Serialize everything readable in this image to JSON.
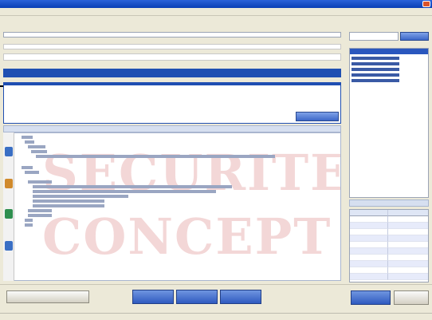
{
  "window": {
    "title": ""
  },
  "menu": {
    "items": []
  },
  "command_line": {
    "value": ""
  },
  "section": {
    "label": ""
  },
  "input_strip": {
    "value": ""
  },
  "text_area": {
    "lines": [
      "",
      "",
      ""
    ]
  },
  "ok_button": {
    "label": ""
  },
  "tree": {
    "header": "",
    "watermark": {
      "line1": "SECURITE",
      "line2": "CONCEPT"
    },
    "rows": [
      {
        "text": ""
      },
      {
        "text": ""
      },
      {
        "text": ""
      },
      {
        "text": ""
      },
      {
        "text": ""
      },
      {
        "text": ""
      },
      {
        "text": ""
      },
      {
        "text": ""
      },
      {
        "text": ""
      },
      {
        "text": ""
      },
      {
        "text": ""
      },
      {
        "text": ""
      },
      {
        "text": ""
      },
      {
        "text": ""
      },
      {
        "text": ""
      },
      {
        "text": ""
      },
      {
        "text": ""
      }
    ]
  },
  "search": {
    "placeholder": "",
    "button_label": ""
  },
  "list_panel": {
    "header": "",
    "items": [
      {
        "label": ""
      },
      {
        "label": ""
      },
      {
        "label": ""
      },
      {
        "label": ""
      },
      {
        "label": ""
      }
    ]
  },
  "table_panel": {
    "columns": [
      "",
      ""
    ],
    "rows": []
  },
  "bottom_bar": {
    "left_button": "",
    "time": "",
    "tabs": [
      "",
      "",
      ""
    ],
    "right_button_1": "",
    "right_button_2": ""
  },
  "statusbar": {
    "text": ""
  },
  "colors": {
    "selection": "#1f4fb2",
    "title_bar": "#0a3fb5",
    "watermark": "#c84848"
  }
}
